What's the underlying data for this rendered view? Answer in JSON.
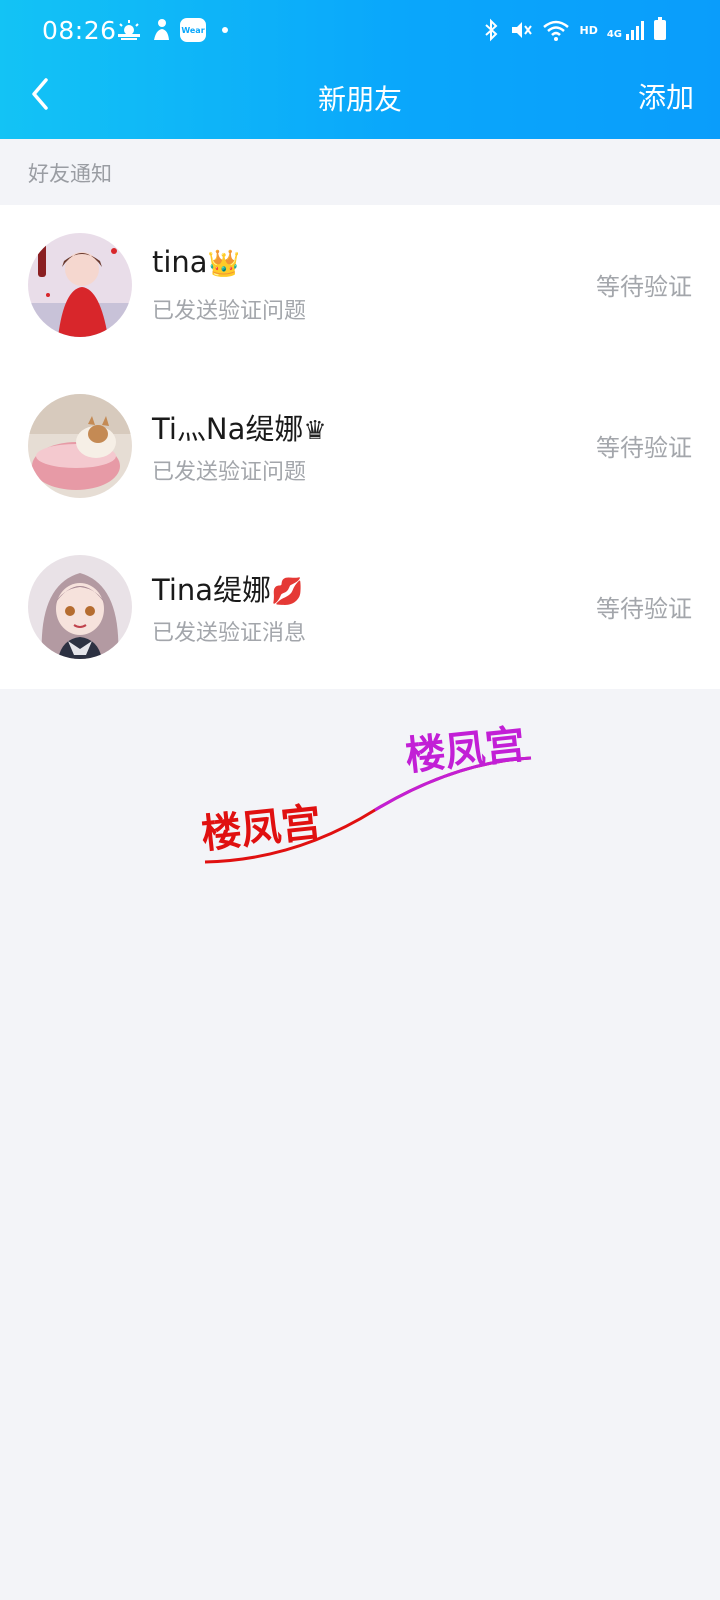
{
  "status_bar": {
    "time": "08:26",
    "left_icons": [
      "weather-icon",
      "person-icon",
      "wear-icon",
      "dot-icon"
    ],
    "wear_label": "Wear",
    "right_icons": [
      "bluetooth-icon",
      "vibrate-icon",
      "wifi-icon",
      "hd-icon",
      "4g-signal-icon",
      "battery-icon"
    ],
    "hd_label": "HD",
    "network_label": "4G"
  },
  "nav": {
    "title": "新朋友",
    "action": "添加"
  },
  "section": {
    "label": "好友通知"
  },
  "friends": [
    {
      "name": "tina",
      "emoji": "👑",
      "subtitle": "已发送验证问题",
      "status": "等待验证"
    },
    {
      "name": "Ti灬Na缇娜",
      "emoji": "♛",
      "subtitle": "已发送验证问题",
      "status": "等待验证"
    },
    {
      "name": "Tina缇娜",
      "emoji": "💋",
      "subtitle": "已发送验证消息",
      "status": "等待验证"
    }
  ],
  "watermark": {
    "text_left": "楼凤宫",
    "text_right": "楼凤宫",
    "color_left": "#e01010",
    "color_right": "#c21fd6"
  },
  "colors": {
    "header_gradient_start": "#13c3f5",
    "header_gradient_end": "#0a9dfb",
    "background": "#f3f4f8",
    "muted_text": "#a3a6ab"
  }
}
